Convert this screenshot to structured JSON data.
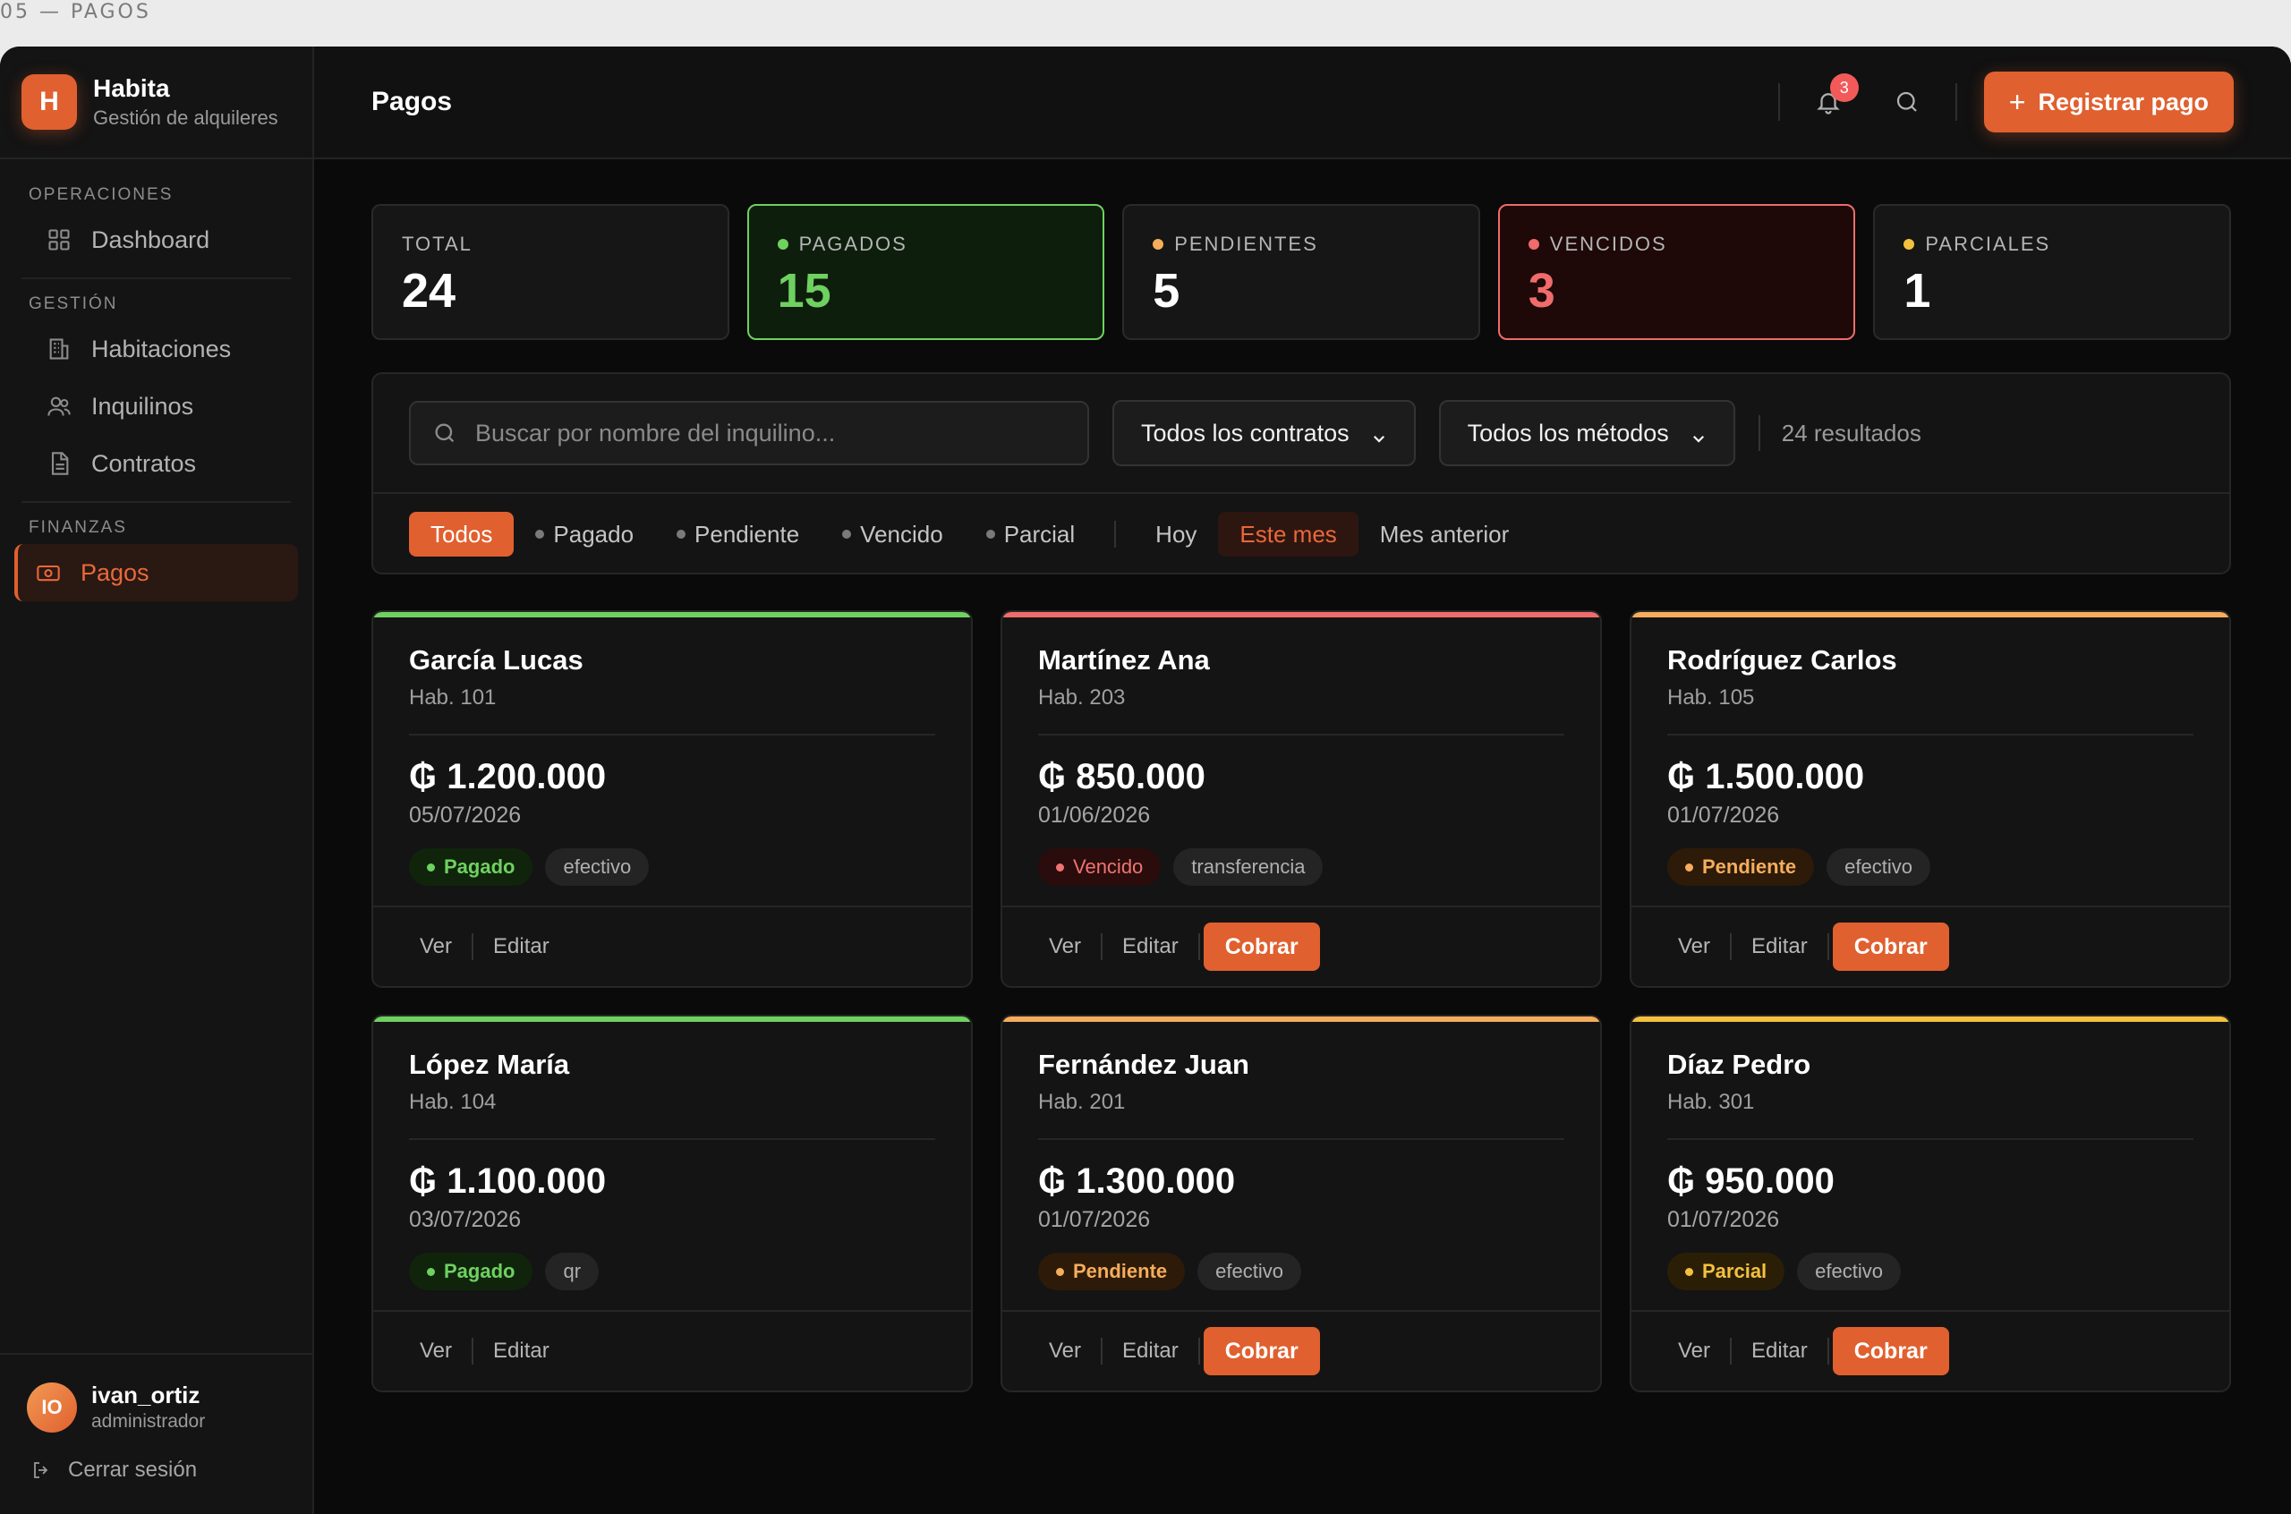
{
  "window_caption": "05 — PAGOS",
  "brand": {
    "logo_letter": "H",
    "name": "Habita",
    "subtitle": "Gestión de alquileres"
  },
  "sidebar": {
    "sections": [
      {
        "label": "OPERACIONES",
        "items": [
          {
            "label": "Dashboard",
            "icon": "grid-icon"
          }
        ]
      },
      {
        "label": "GESTIÓN",
        "items": [
          {
            "label": "Habitaciones",
            "icon": "building-icon"
          },
          {
            "label": "Inquilinos",
            "icon": "users-icon"
          },
          {
            "label": "Contratos",
            "icon": "document-icon"
          }
        ]
      },
      {
        "label": "FINANZAS",
        "items": [
          {
            "label": "Pagos",
            "icon": "money-icon",
            "active": true
          }
        ]
      }
    ]
  },
  "user": {
    "initials": "IO",
    "name": "ivan_ortiz",
    "role": "administrador",
    "logout_label": "Cerrar sesión"
  },
  "header": {
    "title": "Pagos",
    "notification_count": "3",
    "register_label": "Registrar pago"
  },
  "stats": [
    {
      "label": "TOTAL",
      "value": "24"
    },
    {
      "label": "PAGADOS",
      "value": "15",
      "color": "#6fd160"
    },
    {
      "label": "PENDIENTES",
      "value": "5",
      "color": "#f5ad5c"
    },
    {
      "label": "VENCIDOS",
      "value": "3",
      "color": "#f06b6b"
    },
    {
      "label": "PARCIALES",
      "value": "1",
      "color": "#f4c13e"
    }
  ],
  "filters": {
    "search_placeholder": "Buscar por nombre del inquilino...",
    "contract_select": "Todos los contratos",
    "method_select": "Todos los métodos",
    "results": "24 resultados",
    "status_chips": [
      "Todos",
      "Pagado",
      "Pendiente",
      "Vencido",
      "Parcial"
    ],
    "period_chips": [
      "Hoy",
      "Este mes",
      "Mes anterior"
    ]
  },
  "card_actions": {
    "view": "Ver",
    "edit": "Editar",
    "charge": "Cobrar"
  },
  "payments": [
    {
      "tenant": "García Lucas",
      "room": "Hab. 101",
      "amount": "₲ 1.200.000",
      "date": "05/07/2026",
      "status": "Pagado",
      "method": "efectivo",
      "accent": "#6fd160"
    },
    {
      "tenant": "Martínez Ana",
      "room": "Hab. 203",
      "amount": "₲ 850.000",
      "date": "01/06/2026",
      "status": "Vencido",
      "method": "transferencia",
      "accent": "#f06b6b"
    },
    {
      "tenant": "Rodríguez Carlos",
      "room": "Hab. 105",
      "amount": "₲ 1.500.000",
      "date": "01/07/2026",
      "status": "Pendiente",
      "method": "efectivo",
      "accent": "#f5ad5c"
    },
    {
      "tenant": "López María",
      "room": "Hab. 104",
      "amount": "₲ 1.100.000",
      "date": "03/07/2026",
      "status": "Pagado",
      "method": "qr",
      "accent": "#6fd160"
    },
    {
      "tenant": "Fernández Juan",
      "room": "Hab. 201",
      "amount": "₲ 1.300.000",
      "date": "01/07/2026",
      "status": "Pendiente",
      "method": "efectivo",
      "accent": "#f5ad5c"
    },
    {
      "tenant": "Díaz Pedro",
      "room": "Hab. 301",
      "amount": "₲ 950.000",
      "date": "01/07/2026",
      "status": "Parcial",
      "method": "efectivo",
      "accent": "#f4c13e"
    }
  ]
}
